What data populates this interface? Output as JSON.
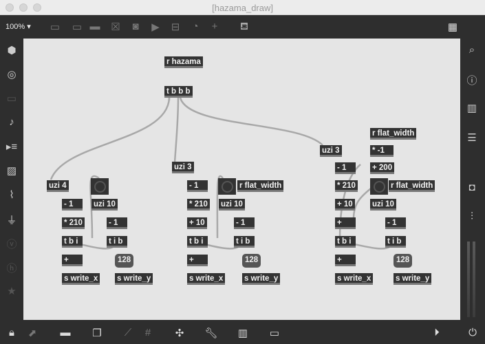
{
  "window": {
    "title": "[hazama_draw]"
  },
  "toolbar": {
    "zoom": "100%",
    "icons": [
      "presentation-icon",
      "message-icon",
      "comment-icon",
      "toggle-icon",
      "button-icon",
      "play-icon",
      "slider-icon",
      "dial-icon",
      "add-icon",
      "paint-bucket-icon",
      "grid-icon"
    ]
  },
  "left_sidebar": [
    "cube-icon",
    "target-icon",
    "keyboard-icon",
    "music-note-icon",
    "playlist-icon",
    "image-icon",
    "paperclip-icon",
    "plug-icon",
    "v-icon",
    "h-icon",
    "star-icon"
  ],
  "right_sidebar": [
    "search-icon",
    "info-icon",
    "book-icon",
    "list-icon",
    "camera-icon",
    "mixer-icon"
  ],
  "bottom_bar": [
    "lock-icon",
    "edit-icon",
    "presentation-icon",
    "windows-icon",
    "patchcord-icon",
    "grid-icon",
    "snap-icon",
    "wrench-icon",
    "piano-icon",
    "keyboard-icon",
    "play-icon",
    "power-icon"
  ],
  "patch": {
    "objects": [
      "r hazama",
      "t b b b",
      "uzi 4",
      "- 1",
      "uzi 10",
      "* 210",
      "- 1",
      "t b i",
      "t i b",
      "+",
      "s write_x",
      "s write_y",
      "uzi 3",
      "r flat_width",
      "- 1",
      "uzi 10",
      "* 210",
      "- 1",
      "+ 10",
      "t b i",
      "t i b",
      "+",
      "s write_x",
      "s write_y",
      "uzi 3",
      "r flat_width",
      "* -1",
      "+ 200",
      "r flat_width",
      "- 1",
      "* 210",
      "+ 10",
      "uzi 10",
      "+",
      "- 1",
      "t b i",
      "t i b",
      "+",
      "s write_x",
      "s write_y"
    ],
    "numbers": [
      "128",
      "128",
      "128"
    ]
  }
}
